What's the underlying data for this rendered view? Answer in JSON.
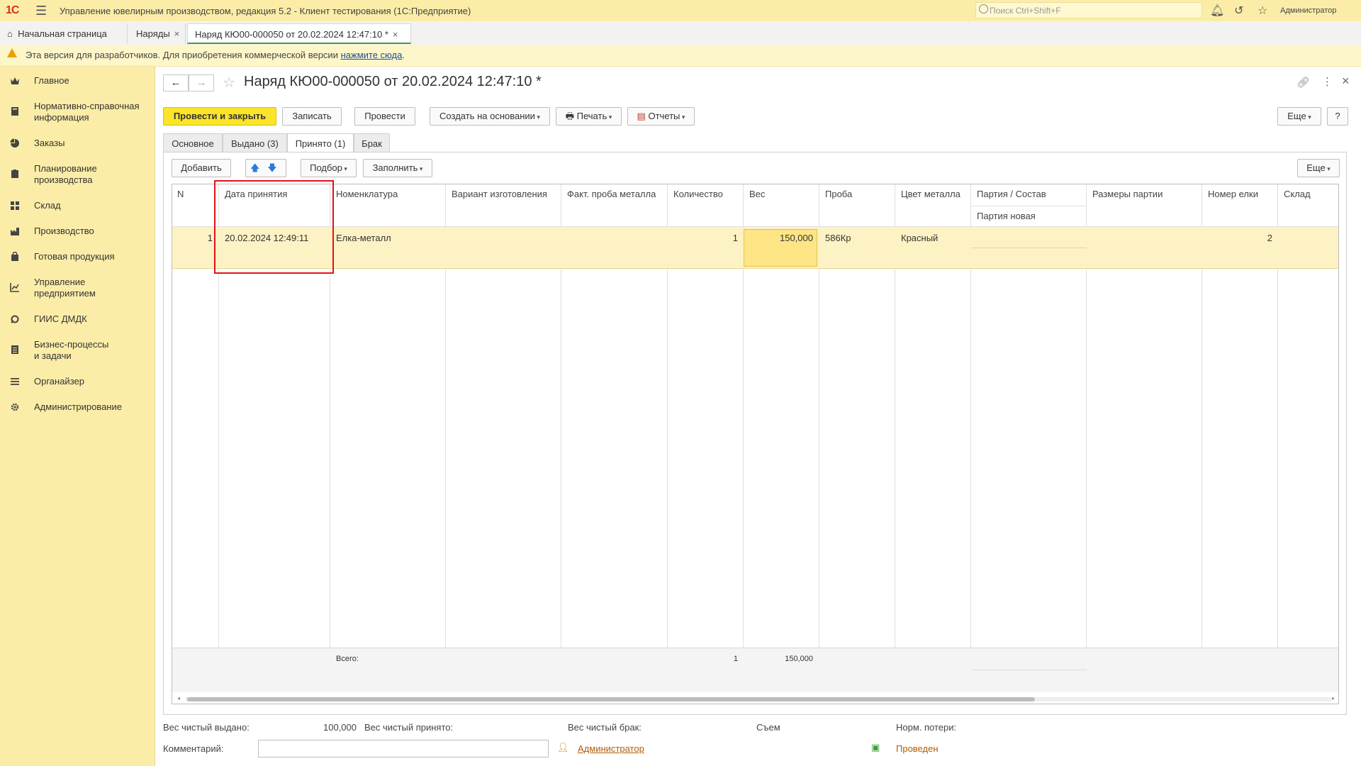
{
  "app": {
    "logo": "1С",
    "title": "Управление ювелирным производством, редакция 5.2 - Клиент тестирования (1С:Предприятие)",
    "search_placeholder": "Поиск Ctrl+Shift+F",
    "user": "Администратор"
  },
  "tabs": [
    {
      "label": "Начальная страница"
    },
    {
      "label": "Наряды"
    },
    {
      "label": "Наряд КЮ00-000050 от 20.02.2024 12:47:10 *"
    }
  ],
  "banner": {
    "text": "Эта версия для разработчиков. Для приобретения коммерческой версии",
    "link": "нажмите сюда",
    "tail": "."
  },
  "sidebar": {
    "items": [
      {
        "label": "Главное",
        "icon": "crown-icon"
      },
      {
        "label": "Нормативно-справочная\nинформация",
        "icon": "book-icon"
      },
      {
        "label": "Заказы",
        "icon": "pie-icon"
      },
      {
        "label": "Планирование\nпроизводства",
        "icon": "clipboard-icon"
      },
      {
        "label": "Склад",
        "icon": "grid-icon"
      },
      {
        "label": "Производство",
        "icon": "factory-icon"
      },
      {
        "label": "Готовая продукция",
        "icon": "bag-icon"
      },
      {
        "label": "Управление\nпредприятием",
        "icon": "chart-icon"
      },
      {
        "label": "ГИИС ДМДК",
        "icon": "gear-link-icon"
      },
      {
        "label": "Бизнес-процессы\nи задачи",
        "icon": "list-icon"
      },
      {
        "label": "Органайзер",
        "icon": "organizer-icon"
      },
      {
        "label": "Администрирование",
        "icon": "gear-icon"
      }
    ]
  },
  "form": {
    "title": "Наряд КЮ00-000050 от 20.02.2024 12:47:10 *",
    "toolbar": {
      "post_close": "Провести и закрыть",
      "save": "Записать",
      "post": "Провести",
      "create_based": "Создать на основании",
      "print": "Печать",
      "reports": "Отчеты",
      "more": "Еще",
      "help": "?"
    },
    "inner_tabs": [
      "Основное",
      "Выдано (3)",
      "Принято (1)",
      "Брак"
    ],
    "table_toolbar": {
      "add": "Добавить",
      "selection": "Подбор",
      "fill": "Заполнить",
      "more": "Еще"
    },
    "table": {
      "columns": [
        "N",
        "Дата принятия",
        "Номенклатура",
        "Вариант изготовления",
        "Факт. проба металла",
        "Количество",
        "Вес",
        "Проба",
        "Цвет металла",
        "Партия / Состав",
        "Размеры партии",
        "Номер елки",
        "Склад"
      ],
      "subheader": "Партия новая",
      "rows": [
        {
          "n": "1",
          "date": "20.02.2024 12:49:11",
          "nomenclature": "Елка-металл",
          "variant": "",
          "fact_proba": "",
          "qty": "1",
          "weight": "150,000",
          "proba": "586Кр",
          "color": "Красный",
          "batch": "",
          "batch_size": "",
          "tree_no": "2",
          "warehouse": ""
        }
      ],
      "footer": {
        "label": "Всего:",
        "qty": "1",
        "weight": "150,000"
      }
    },
    "bottom": {
      "net_issued_label": "Вес чистый выдано:",
      "net_issued_value": "100,000",
      "net_received_label": "Вес чистый принято:",
      "net_defect_label": "Вес чистый брак:",
      "removal_label": "Съем",
      "loss_label": "Норм. потери:",
      "comment_label": "Комментарий:",
      "comment_value": "",
      "author": "Администратор",
      "status": "Проведен"
    }
  },
  "colors": {
    "accent_yellow": "#fbe42a",
    "sidebar_bg": "#fbeda7",
    "highlight_red": "#e3111b",
    "row_selected": "#fdf2c4",
    "link": "#1c4e95"
  }
}
